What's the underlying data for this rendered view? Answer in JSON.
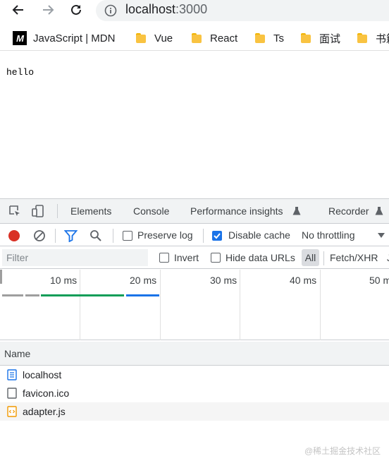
{
  "browser": {
    "address": {
      "host": "localhost",
      "port": ":3000"
    },
    "bookmarks": [
      {
        "label": "JavaScript | MDN",
        "icon": "mdn-logo-icon"
      },
      {
        "label": "Vue",
        "icon": "folder-icon"
      },
      {
        "label": "React",
        "icon": "folder-icon"
      },
      {
        "label": "Ts",
        "icon": "folder-icon"
      },
      {
        "label": "面试",
        "icon": "folder-icon"
      },
      {
        "label": "书籍",
        "icon": "folder-icon"
      }
    ],
    "mdn_logo_text": "M"
  },
  "page": {
    "content": "hello"
  },
  "devtools": {
    "tabs": [
      "Elements",
      "Console",
      "Performance insights",
      "Recorder"
    ],
    "network_toolbar": {
      "preserve_log": {
        "label": "Preserve log",
        "checked": false
      },
      "disable_cache": {
        "label": "Disable cache",
        "checked": true
      },
      "throttling": "No throttling"
    },
    "filter_bar": {
      "filter_placeholder": "Filter",
      "invert": {
        "label": "Invert",
        "checked": false
      },
      "hide_data_urls": {
        "label": "Hide data URLs",
        "checked": false
      },
      "type_all": "All",
      "type_fetch": "Fetch/XHR"
    },
    "timeline": {
      "ticks": [
        "10 ms",
        "20 ms",
        "30 ms",
        "40 ms",
        "50 ms"
      ],
      "colors": {
        "gray": "#9e9e9e",
        "green": "#0f9d58",
        "blue": "#1a73e8"
      }
    },
    "requests": {
      "column_name": "Name",
      "rows": [
        {
          "name": "localhost",
          "icon": "document-icon"
        },
        {
          "name": "favicon.ico",
          "icon": "blank-file-icon"
        },
        {
          "name": "adapter.js",
          "icon": "script-icon"
        }
      ]
    },
    "colors": {
      "record": "#d93025",
      "accent": "#1a73e8"
    }
  },
  "watermark": "@稀土掘金技术社区"
}
